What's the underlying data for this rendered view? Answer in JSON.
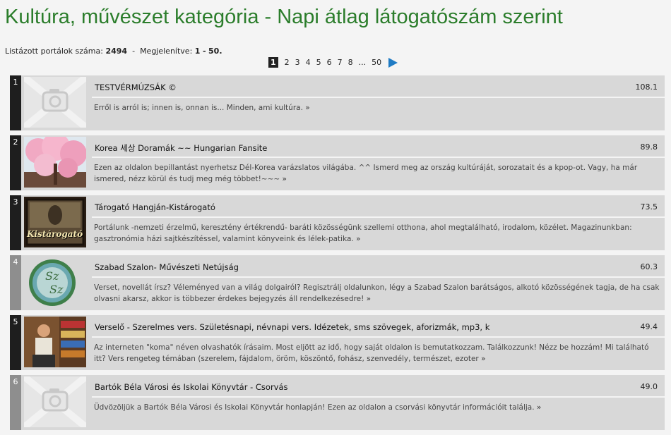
{
  "page_title": "Kultúra, művészet kategória - Napi átlag látogatószám szerint",
  "summary": {
    "listed_label": "Listázott portálok száma:",
    "listed_count": "2494",
    "dash": "-",
    "shown_label": "Megjelenítve:",
    "shown_from": "1",
    "shown_sep": "-",
    "shown_to": "50."
  },
  "pagination": {
    "current": "1",
    "pages": [
      "2",
      "3",
      "4",
      "5",
      "6",
      "7",
      "8"
    ],
    "ellipsis": "...",
    "last": "50",
    "next_icon": "next-arrow-icon"
  },
  "items": [
    {
      "rank": "1",
      "name": "TESTVÉRMÚZSÁK ©",
      "score": "108.1",
      "desc": "Erről is arról is; innen is, onnan is... Minden, ami kultúra.",
      "more": "»",
      "rank_style": "dark",
      "thumb": "placeholder-photo-icon"
    },
    {
      "rank": "2",
      "name": "Korea 세상 Doramák ~~ Hungarian Fansite",
      "score": "89.8",
      "desc": "Ezen az oldalon bepillantást nyerhetsz Dél-Korea varázslatos világába. ^^ Ismerd meg az ország kultúráját, sorozatait és a kpop-ot. Vagy, ha már ismered, nézz körül és tudj meg még többet!~~~",
      "more": "»",
      "rank_style": "dark",
      "thumb": "cherry-blossom-thumbnail"
    },
    {
      "rank": "3",
      "name": "Tárogató Hangján-Kistárogató",
      "score": "73.5",
      "desc": "Portálunk -nemzeti érzelmű, keresztény értékrendű- baráti közösségünk szellemi otthona, ahol megtalálható, irodalom, közélet. Magazinunkban: gasztronómia házi sajtkészítéssel, valamint könyveink és lélek-patika.",
      "more": "»",
      "rank_style": "dark",
      "thumb": "kistarogato-thumbnail",
      "thumb_text": "Kistárogató"
    },
    {
      "rank": "4",
      "name": "Szabad Szalon- Művészeti Netújság",
      "score": "60.3",
      "desc": "Verset, novellát írsz? Véleményed van a világ dolgairól? Regisztrálj oldalunkon, légy a Szabad Szalon barátságos, alkotó közösségének tagja, de ha csak olvasni akarsz, akkor is többezer érdekes bejegyzés áll rendelkezésedre!",
      "more": "»",
      "rank_style": "light",
      "thumb": "sz-sz-logo"
    },
    {
      "rank": "5",
      "name": "Verselő - Szerelmes vers. Születésnapi, névnapi vers. Idézetek, sms szövegek, aforizmák, mp3, k",
      "score": "49.4",
      "desc": "Az interneten \"koma\" néven olvashatók írásaim. Most eljött az idő, hogy saját oldalon is bemutatkozzam. Találkozzunk! Nézz be hozzám! Mi található itt? Vers rengeteg témában (szerelem, fájdalom, öröm, köszöntő, fohász, szenvedély, természet, ezoter",
      "more": "»",
      "rank_style": "dark",
      "thumb": "person-bookshelf-thumbnail"
    },
    {
      "rank": "6",
      "name": "Bartók Béla Városi és Iskolai Könyvtár - Csorvás",
      "score": "49.0",
      "desc": "Üdvözöljük a Bartók Béla Városi és Iskolai Könyvtár honlapján! Ezen az oldalon a csorvási könyvtár információit találja.",
      "more": "»",
      "rank_style": "light",
      "thumb": "placeholder-photo-icon"
    }
  ],
  "colors": {
    "title": "#2b7d2b",
    "next_arrow": "#1f7bc4",
    "row_bg": "#d8d8d8"
  }
}
